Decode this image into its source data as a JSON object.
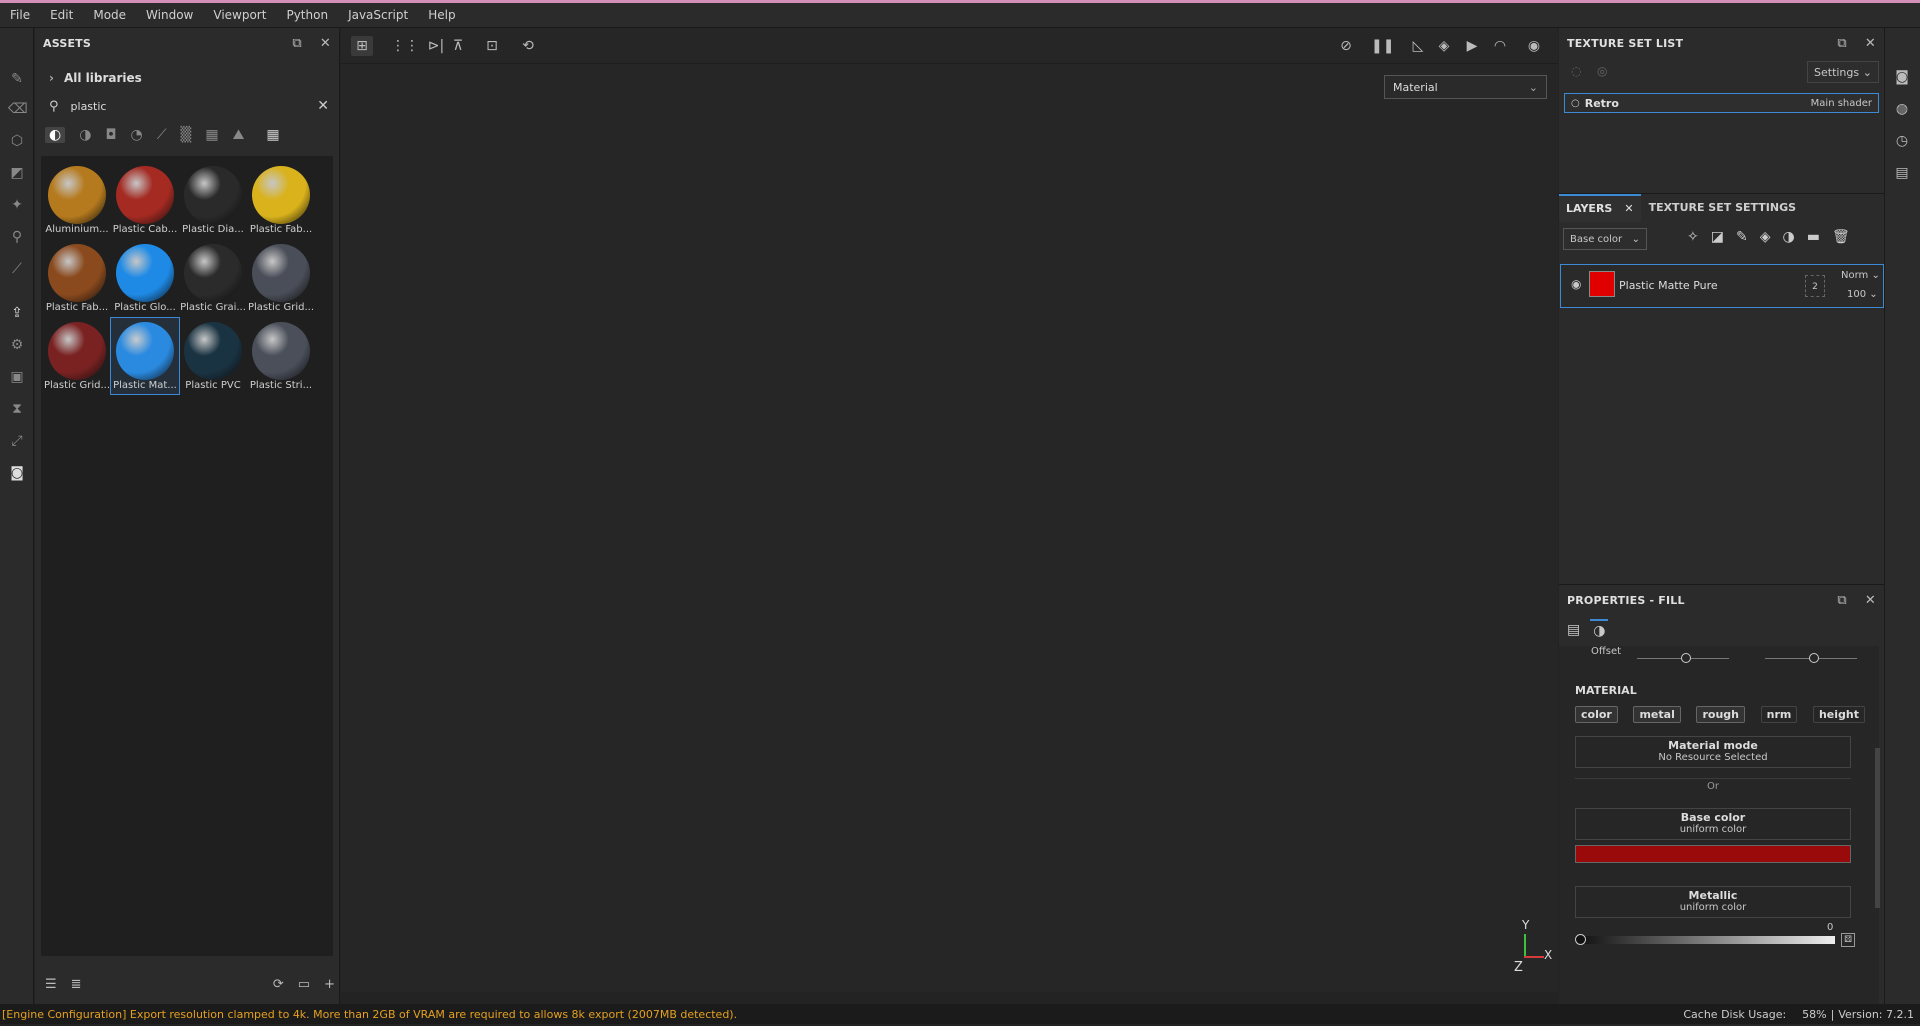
{
  "menu": [
    "File",
    "Edit",
    "Mode",
    "Window",
    "Viewport",
    "Python",
    "JavaScript",
    "Help"
  ],
  "assets": {
    "title": "ASSETS",
    "breadcrumb": "All libraries",
    "search_value": "plastic",
    "items": [
      {
        "label": "Aluminium...",
        "color": "#b57a1e"
      },
      {
        "label": "Plastic Cab...",
        "color": "#a42a22"
      },
      {
        "label": "Plastic Dia...",
        "color": "#2a2a2a"
      },
      {
        "label": "Plastic Fab...",
        "color": "#d9b21c"
      },
      {
        "label": "Plastic Fab...",
        "color": "#8a4a1e"
      },
      {
        "label": "Plastic Glo...",
        "color": "#1e8ae6"
      },
      {
        "label": "Plastic Grai...",
        "color": "#2b2b2b"
      },
      {
        "label": "Plastic Grid...",
        "color": "#4a4e58"
      },
      {
        "label": "Plastic Grid...",
        "color": "#7a2222"
      },
      {
        "label": "Plastic Mat...",
        "color": "#2a8ae0"
      },
      {
        "label": "Plastic PVC",
        "color": "#1a3342"
      },
      {
        "label": "Plastic Stri...",
        "color": "#4a4f5a"
      }
    ],
    "selected_index": 9
  },
  "viewport": {
    "mode_select": "Material",
    "axis_y": "Y",
    "axis_x": "X",
    "axis_z": "Z"
  },
  "texture_set_list": {
    "title": "TEXTURE SET LIST",
    "settings_label": "Settings",
    "item_name": "Retro",
    "item_shader": "Main shader"
  },
  "layers": {
    "tab_layers": "LAYERS",
    "tab_tss": "TEXTURE SET SETTINGS",
    "channel_select": "Base color",
    "layer_name": "Plastic Matte Pure",
    "layer_color": "#e00000",
    "blend_mode": "Norm",
    "opacity": "100",
    "mask_count": "2"
  },
  "properties": {
    "title": "PROPERTIES - FILL",
    "offset_label": "Offset",
    "material_heading": "MATERIAL",
    "channels": [
      "color",
      "metal",
      "rough",
      "nrm",
      "height"
    ],
    "material_mode_title": "Material mode",
    "material_mode_value": "No Resource Selected",
    "or_label": "Or",
    "base_color_title": "Base color",
    "base_color_sub": "uniform color",
    "base_color_hex": "#9b0a0a",
    "metallic_title": "Metallic",
    "metallic_sub": "uniform color",
    "metallic_value": "0"
  },
  "status": {
    "message": "[Engine Configuration] Export resolution clamped to 4k. More than 2GB of VRAM are required to allows 8k export (2007MB detected).",
    "cache_label": "Cache Disk Usage:",
    "cache_value": "58%",
    "version": "Version: 7.2.1"
  }
}
